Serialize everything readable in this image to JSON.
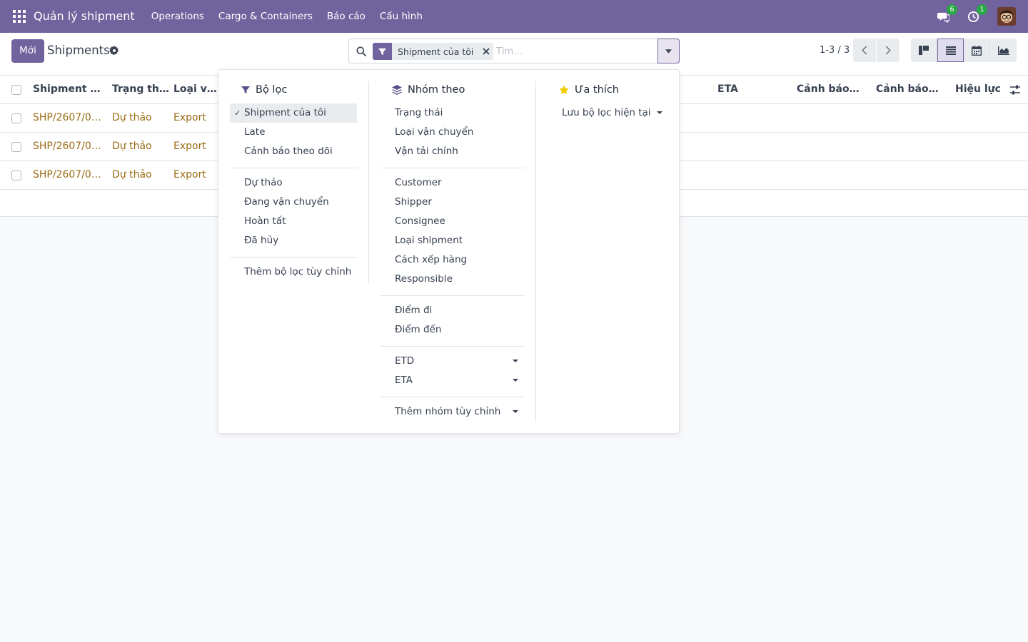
{
  "navbar": {
    "brand": "Quản lý shipment",
    "menu": [
      "Operations",
      "Cargo & Containers",
      "Báo cáo",
      "Cấu hình"
    ],
    "messages_count": "6",
    "activities_count": "1"
  },
  "control": {
    "new_label": "Mới",
    "title": "Shipments",
    "facet_label": "Shipment của tôi",
    "search_placeholder": "Tìm...",
    "pager": "1-3 / 3"
  },
  "list": {
    "columns": [
      "Shipment R...",
      "Trạng thái",
      "Loại vận c",
      "ETA",
      "Cảnh báo t...",
      "Cảnh báo c...",
      "Hiệu lực"
    ],
    "rows": [
      [
        "SHP/2607/00...",
        "Dự thảo",
        "Export"
      ],
      [
        "SHP/2607/00...",
        "Dự thảo",
        "Export"
      ],
      [
        "SHP/2607/00...",
        "Dự thảo",
        "Export"
      ]
    ]
  },
  "dropdown": {
    "filters_title": "Bộ lọc",
    "filters_group1": [
      "Shipment của tôi",
      "Late",
      "Cảnh báo theo dõi"
    ],
    "filters_group2": [
      "Dự thảo",
      "Đang vận chuyển",
      "Hoàn tất",
      "Đã hủy"
    ],
    "add_custom_filter": "Thêm bộ lọc tùy chỉnh",
    "groupby_title": "Nhóm theo",
    "groupby_group1": [
      "Trạng thái",
      "Loại vận chuyển",
      "Vận tải chính"
    ],
    "groupby_group2": [
      "Customer",
      "Shipper",
      "Consignee",
      "Loại shipment",
      "Cách xếp hàng",
      "Responsible"
    ],
    "groupby_group3": [
      "Điểm đi",
      "Điểm đến"
    ],
    "groupby_dates": [
      "ETD",
      "ETA"
    ],
    "add_custom_group": "Thêm nhóm tùy chỉnh",
    "favorites_title": "Ưa thích",
    "save_current_filter": "Lưu bộ lọc hiện tại"
  },
  "colors": {
    "primary": "#71639e",
    "link": "#9a6b14",
    "badge": "#28a745",
    "star": "#f3cc00"
  }
}
